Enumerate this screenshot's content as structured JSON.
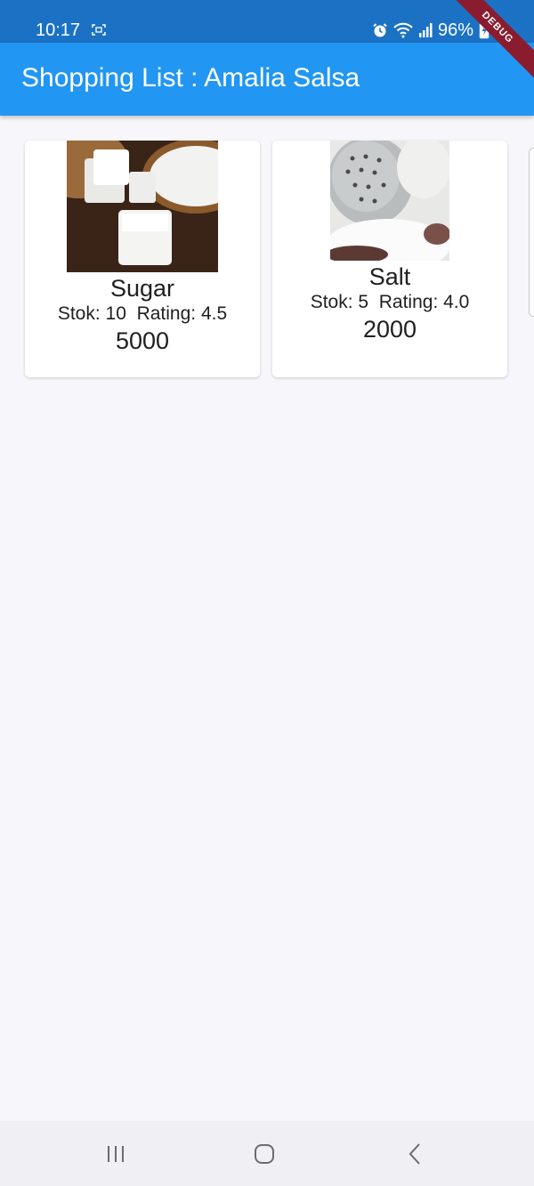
{
  "status_bar": {
    "time": "10:17",
    "battery": "96%",
    "icons": [
      "screenshot-icon",
      "alarm-icon",
      "wifi-icon",
      "signal-icon",
      "battery-charging-icon"
    ]
  },
  "debug_banner": "DEBUG",
  "app_bar": {
    "title": "Shopping List : Amalia Salsa",
    "color": "#2196f3"
  },
  "products": [
    {
      "name": "Sugar",
      "stok_label": "Stok: 10",
      "rating_label": "Rating: 4.5",
      "price": "5000",
      "image": "sugar-cubes-photo"
    },
    {
      "name": "Salt",
      "stok_label": "Stok: 5",
      "rating_label": "Rating: 4.0",
      "price": "2000",
      "image": "salt-shaker-photo"
    }
  ],
  "nav_bar": {
    "buttons": [
      "recent-apps-icon",
      "home-icon",
      "back-icon"
    ]
  }
}
